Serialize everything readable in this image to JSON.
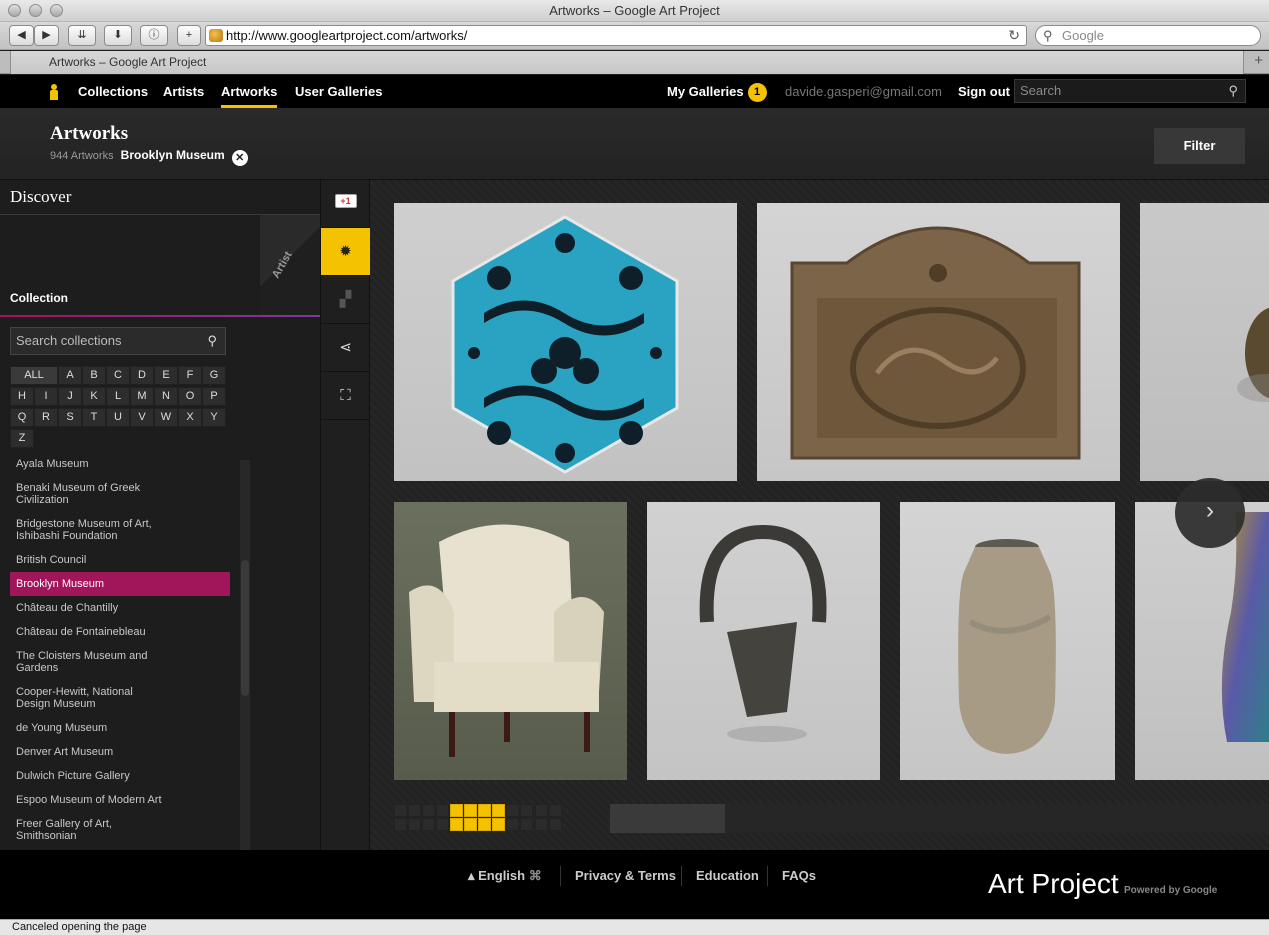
{
  "window": {
    "title": "Artworks – Google Art Project"
  },
  "browser": {
    "url": "http://www.googleartproject.com/artworks/",
    "search_placeholder": "Google",
    "tab_title": "Artworks – Google Art Project",
    "status": "Canceled opening the page"
  },
  "nav": {
    "links": [
      "Collections",
      "Artists",
      "Artworks",
      "User Galleries"
    ],
    "active": "Artworks",
    "my_galleries": "My Galleries",
    "my_galleries_count": "1",
    "email": "davide.gasperi@gmail.com",
    "sign_out": "Sign out",
    "search_placeholder": "Search"
  },
  "page": {
    "title": "Artworks",
    "count": "944 Artworks",
    "filter_museum": "Brooklyn Museum",
    "filter_button": "Filter"
  },
  "sidebar": {
    "heading": "Discover",
    "tab_collection": "Collection",
    "tab_artist": "Artist",
    "search_placeholder": "Search collections",
    "letters": [
      "ALL",
      "A",
      "B",
      "C",
      "D",
      "E",
      "F",
      "G",
      "H",
      "I",
      "J",
      "K",
      "L",
      "M",
      "N",
      "O",
      "P",
      "Q",
      "R",
      "S",
      "T",
      "U",
      "V",
      "W",
      "X",
      "Y",
      "Z"
    ],
    "collections": [
      "Ayala Museum",
      "Benaki Museum of Greek Civilization",
      "Bridgestone Museum of Art, Ishibashi Foundation",
      "British Council",
      "Brooklyn Museum",
      "Château de Chantilly",
      "Château de Fontainebleau",
      "The Cloisters Museum and Gardens",
      "Cooper-Hewitt, National Design Museum",
      "de Young Museum",
      "Denver Art Museum",
      "Dulwich Picture Gallery",
      "Espoo Museum of Modern Art",
      "Freer Gallery of Art, Smithsonian"
    ],
    "selected": "Brooklyn Museum"
  },
  "tools": {
    "plus_one": "+1"
  },
  "grid": {
    "progress": 0.175
  },
  "footer": {
    "language": "English",
    "links": [
      "Privacy & Terms",
      "Education",
      "FAQs"
    ],
    "brand": "Art Project",
    "brand_sub": "Powered by Google"
  },
  "colors": {
    "accent": "#f5c200",
    "selected": "#a1155b"
  }
}
